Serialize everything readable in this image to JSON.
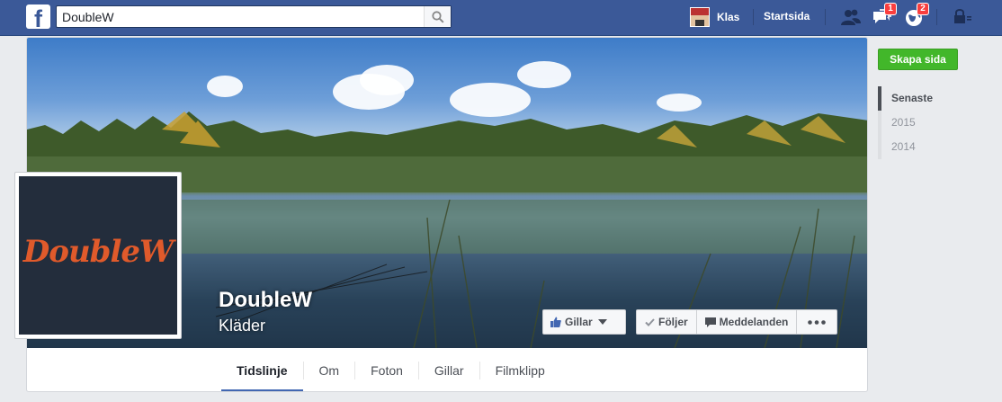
{
  "topbar": {
    "search_value": "DoubleW",
    "user_name": "Klas",
    "home_label": "Startsida",
    "messages_badge": "1",
    "notifications_badge": "2"
  },
  "page": {
    "name": "DoubleW",
    "category": "Kläder",
    "logo_text": "DoubleW"
  },
  "actions": {
    "like_label": "Gillar",
    "follow_label": "Följer",
    "message_label": "Meddelanden"
  },
  "tabs": [
    "Tidslinje",
    "Om",
    "Foton",
    "Gillar",
    "Filmklipp"
  ],
  "sidebar": {
    "create_page_label": "Skapa sida",
    "years": [
      "Senaste",
      "2015",
      "2014"
    ]
  },
  "colors": {
    "brand": "#3b5998",
    "green": "#42b72a",
    "badge": "#fa3e3e",
    "logo_orange": "#e05a2b",
    "logo_bg": "#232d3c"
  }
}
